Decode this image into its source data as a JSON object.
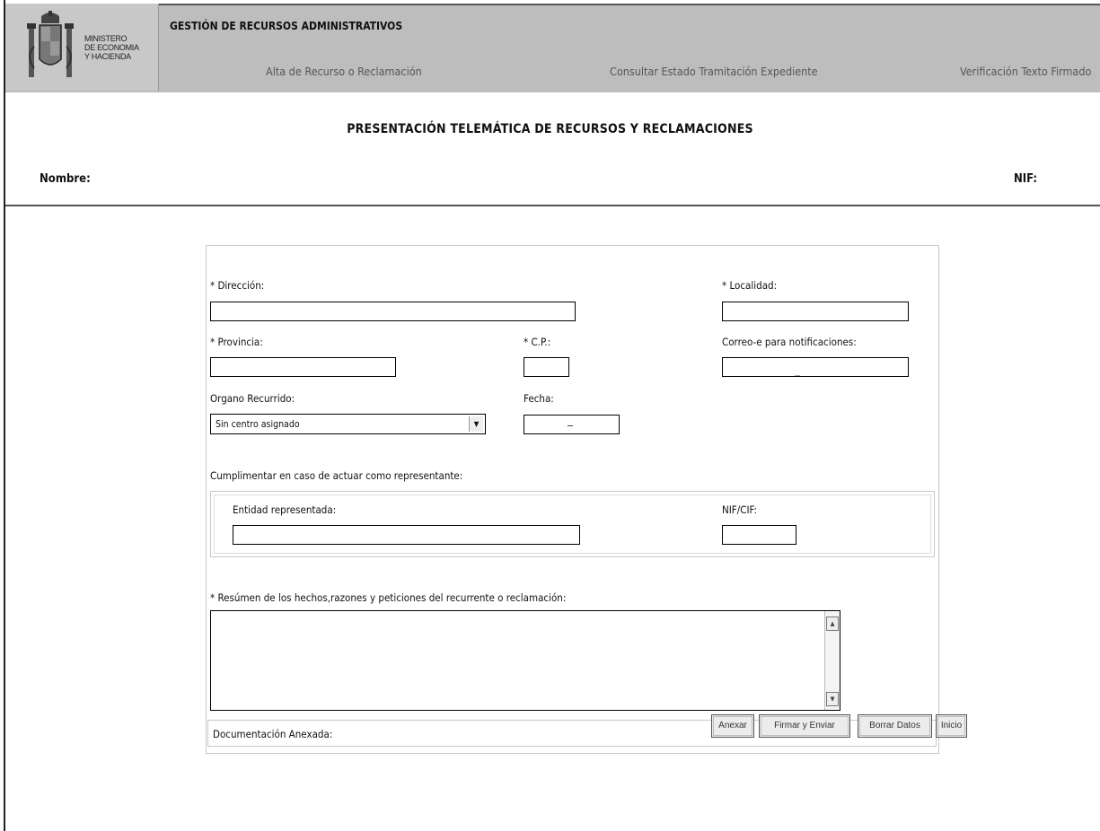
{
  "header": {
    "ministry_lines": [
      "MINISTERO",
      "DE ECONOMIA",
      "Y HACIENDA"
    ],
    "app_title": "GESTIÓN DE RECURSOS ADMINISTRATIVOS",
    "nav": [
      "Alta de Recurso o Reclamación",
      "Consultar Estado Tramitación Expediente",
      "Verificación Texto Firmado"
    ]
  },
  "page": {
    "title": "PRESENTACIÓN TELEMÁTICA DE RECURSOS Y RECLAMACIONES",
    "nombre_label": "Nombre:",
    "nif_label": "NIF:"
  },
  "form": {
    "direccion_label": "* Dirección:",
    "localidad_label": "* Localidad:",
    "provincia_label": "* Provincia:",
    "cp_label": "* C.P.:",
    "email_label": "Correo-e para notificaciones:",
    "organo_label": "Organo Recurrido:",
    "organo_selected": "Sin centro asignado",
    "fecha_label": "Fecha:",
    "representante_label": "Cumplimentar en caso de actuar como representante:",
    "entidad_label": "Entidad representada:",
    "nifcif_label": "NIF/CIF:",
    "resumen_label": "* Resúmen de los hechos,razones y peticiones del recurrente o reclamación:",
    "documentacion_label": "Documentación Anexada:"
  },
  "buttons": {
    "anexar": "Anexar",
    "firmar": "Firmar y Enviar",
    "borrar": "Borrar Datos",
    "inicio": "Inicio"
  },
  "icons": {
    "select_arrow": "chevron-down-icon",
    "scroll_up": "scroll-up-arrow-icon",
    "scroll_down": "scroll-down-arrow-icon"
  }
}
